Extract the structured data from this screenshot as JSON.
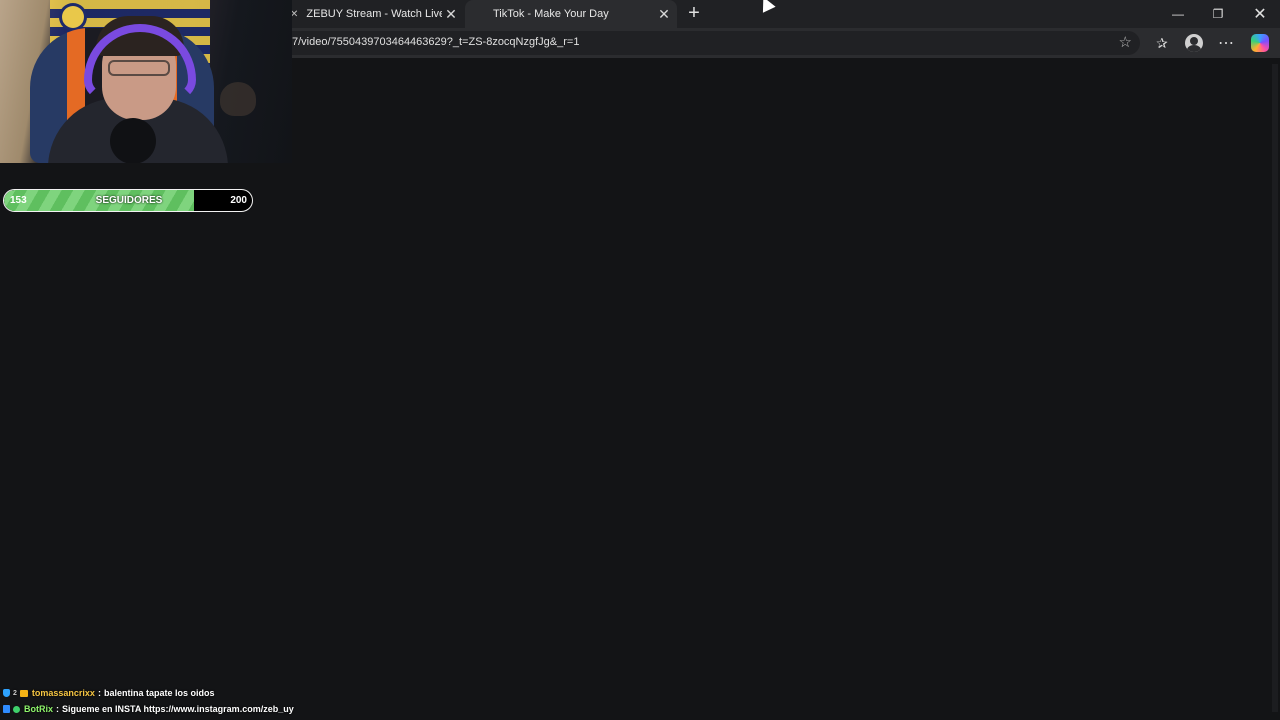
{
  "browser": {
    "tabs": [
      {
        "title": "ZEBUY Stream - Watch Live o",
        "close": "✕"
      },
      {
        "title": "TikTok - Make Your Day",
        "close": "✕"
      }
    ],
    "new_tab": "+",
    "window_controls": {
      "minimize": "—",
      "maximize": "❐",
      "close": "✕"
    },
    "url": "7/video/7550439703464463629?_t=ZS-8zocqNzgfJg&_r=1",
    "icons": [
      "star-icon",
      "favorites-icon",
      "profile-icon",
      "more-icon",
      "copilot-icon"
    ],
    "more_label": "⋯"
  },
  "stream_overlay": {
    "follower_goal": {
      "current": "153",
      "label": "SEGUIDORES",
      "target": "200",
      "progress_fraction": 0.765
    },
    "chat": [
      {
        "badge": "2",
        "user": "tomassancrixx",
        "separator": ":",
        "message": "balentina tapate los oidos"
      },
      {
        "user": "BotRix",
        "separator": ":",
        "message": "Sigueme en INSTA https://www.instagram.com/zeb_uy"
      }
    ]
  },
  "colors": {
    "background": "#131416",
    "goal_fill": "#6fcb6e",
    "chat_user1": "#f5c542",
    "chat_user2": "#8ef56b"
  }
}
